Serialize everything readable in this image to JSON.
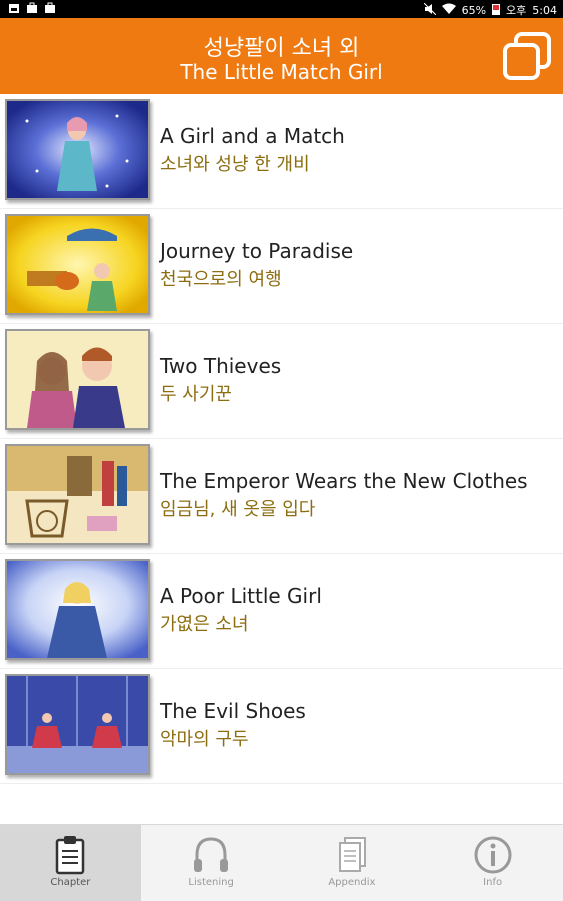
{
  "status_bar": {
    "battery": "65%",
    "period": "오후",
    "time": "5:04"
  },
  "header": {
    "title_ko": "성냥팔이 소녀 외",
    "title_en": "The Little Match Girl"
  },
  "chapters": [
    {
      "title_en": "A Girl and a Match",
      "title_ko": "소녀와 성냥 한 개비"
    },
    {
      "title_en": "Journey to Paradise",
      "title_ko": "천국으로의 여행"
    },
    {
      "title_en": "Two Thieves",
      "title_ko": "두 사기꾼"
    },
    {
      "title_en": "The Emperor Wears the New Clothes",
      "title_ko": "임금님, 새 옷을 입다"
    },
    {
      "title_en": "A Poor Little Girl",
      "title_ko": "가엾은 소녀"
    },
    {
      "title_en": "The Evil Shoes",
      "title_ko": "악마의 구두"
    }
  ],
  "tabs": [
    {
      "label": "Chapter",
      "icon": "clipboard-icon",
      "active": true
    },
    {
      "label": "Listening",
      "icon": "headphones-icon",
      "active": false
    },
    {
      "label": "Appendix",
      "icon": "pages-icon",
      "active": false
    },
    {
      "label": "Info",
      "icon": "info-icon",
      "active": false
    }
  ],
  "colors": {
    "header_bg": "#ef7a12",
    "subtitle_text": "#8c6d10",
    "active_tab_bg": "#d7d7d7"
  }
}
